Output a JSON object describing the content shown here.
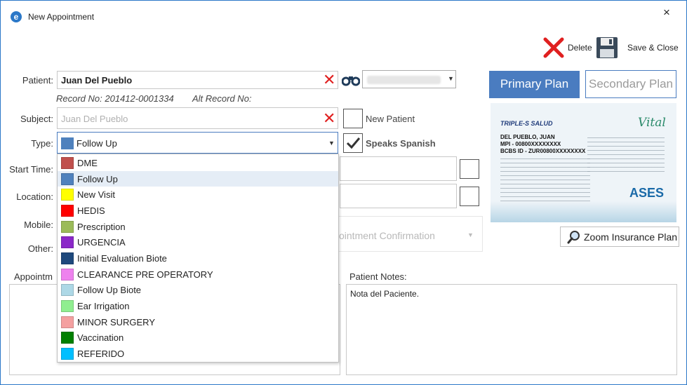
{
  "window": {
    "title": "New Appointment",
    "close_glyph": "×"
  },
  "toolbar": {
    "delete_label": "Delete",
    "save_close_label": "Save & Close"
  },
  "form": {
    "patient_label": "Patient:",
    "patient_value": "Juan Del Pueblo",
    "record_no": "Record No: 201412-0001334",
    "alt_record_no": "Alt Record No:",
    "subject_label": "Subject:",
    "subject_placeholder": "Juan Del Pueblo",
    "type_label": "Type:",
    "type_value": "Follow Up",
    "type_color": "#4f81bd",
    "start_time_label": "Start Time:",
    "location_label": "Location:",
    "mobile_label": "Mobile:",
    "other_label": "Other:",
    "appointment_notes_label": "Appointm",
    "new_patient_label": "New Patient",
    "speaks_spanish_label": "Speaks Spanish",
    "speaks_spanish_checked": true,
    "confirmation_placeholder": "ointment Confirmation",
    "patient_notes_label": "Patient Notes:",
    "patient_notes_value": "Nota del Paciente."
  },
  "plans": {
    "primary": "Primary Plan",
    "secondary": "Secondary Plan",
    "zoom": "Zoom Insurance Plan"
  },
  "card": {
    "insurer": "TRIPLE-S SALUD",
    "brand": "Vital",
    "name": "DEL PUEBLO, JUAN",
    "mpi": "MPI - 00800XXXXXXXX",
    "bcbs": "BCBS ID - ZUR00800XXXXXXXX",
    "ases": "ASES"
  },
  "type_options": [
    {
      "label": "DME",
      "color": "#c0504d"
    },
    {
      "label": "Follow Up",
      "color": "#4f81bd"
    },
    {
      "label": "New Visit",
      "color": "#ffff00"
    },
    {
      "label": "HEDIS",
      "color": "#ff0000"
    },
    {
      "label": "Prescription",
      "color": "#9bbb59"
    },
    {
      "label": "URGENCIA",
      "color": "#8b28c8"
    },
    {
      "label": "Initial Evaluation Biote",
      "color": "#1f497d"
    },
    {
      "label": "CLEARANCE PRE OPERATORY",
      "color": "#ee82ee"
    },
    {
      "label": "Follow Up Biote",
      "color": "#add8e6"
    },
    {
      "label": "Ear Irrigation",
      "color": "#90ee90"
    },
    {
      "label": "MINOR SURGERY",
      "color": "#f4a0a0"
    },
    {
      "label": "Vaccination",
      "color": "#008000"
    },
    {
      "label": "REFERIDO",
      "color": "#00bfff"
    }
  ]
}
